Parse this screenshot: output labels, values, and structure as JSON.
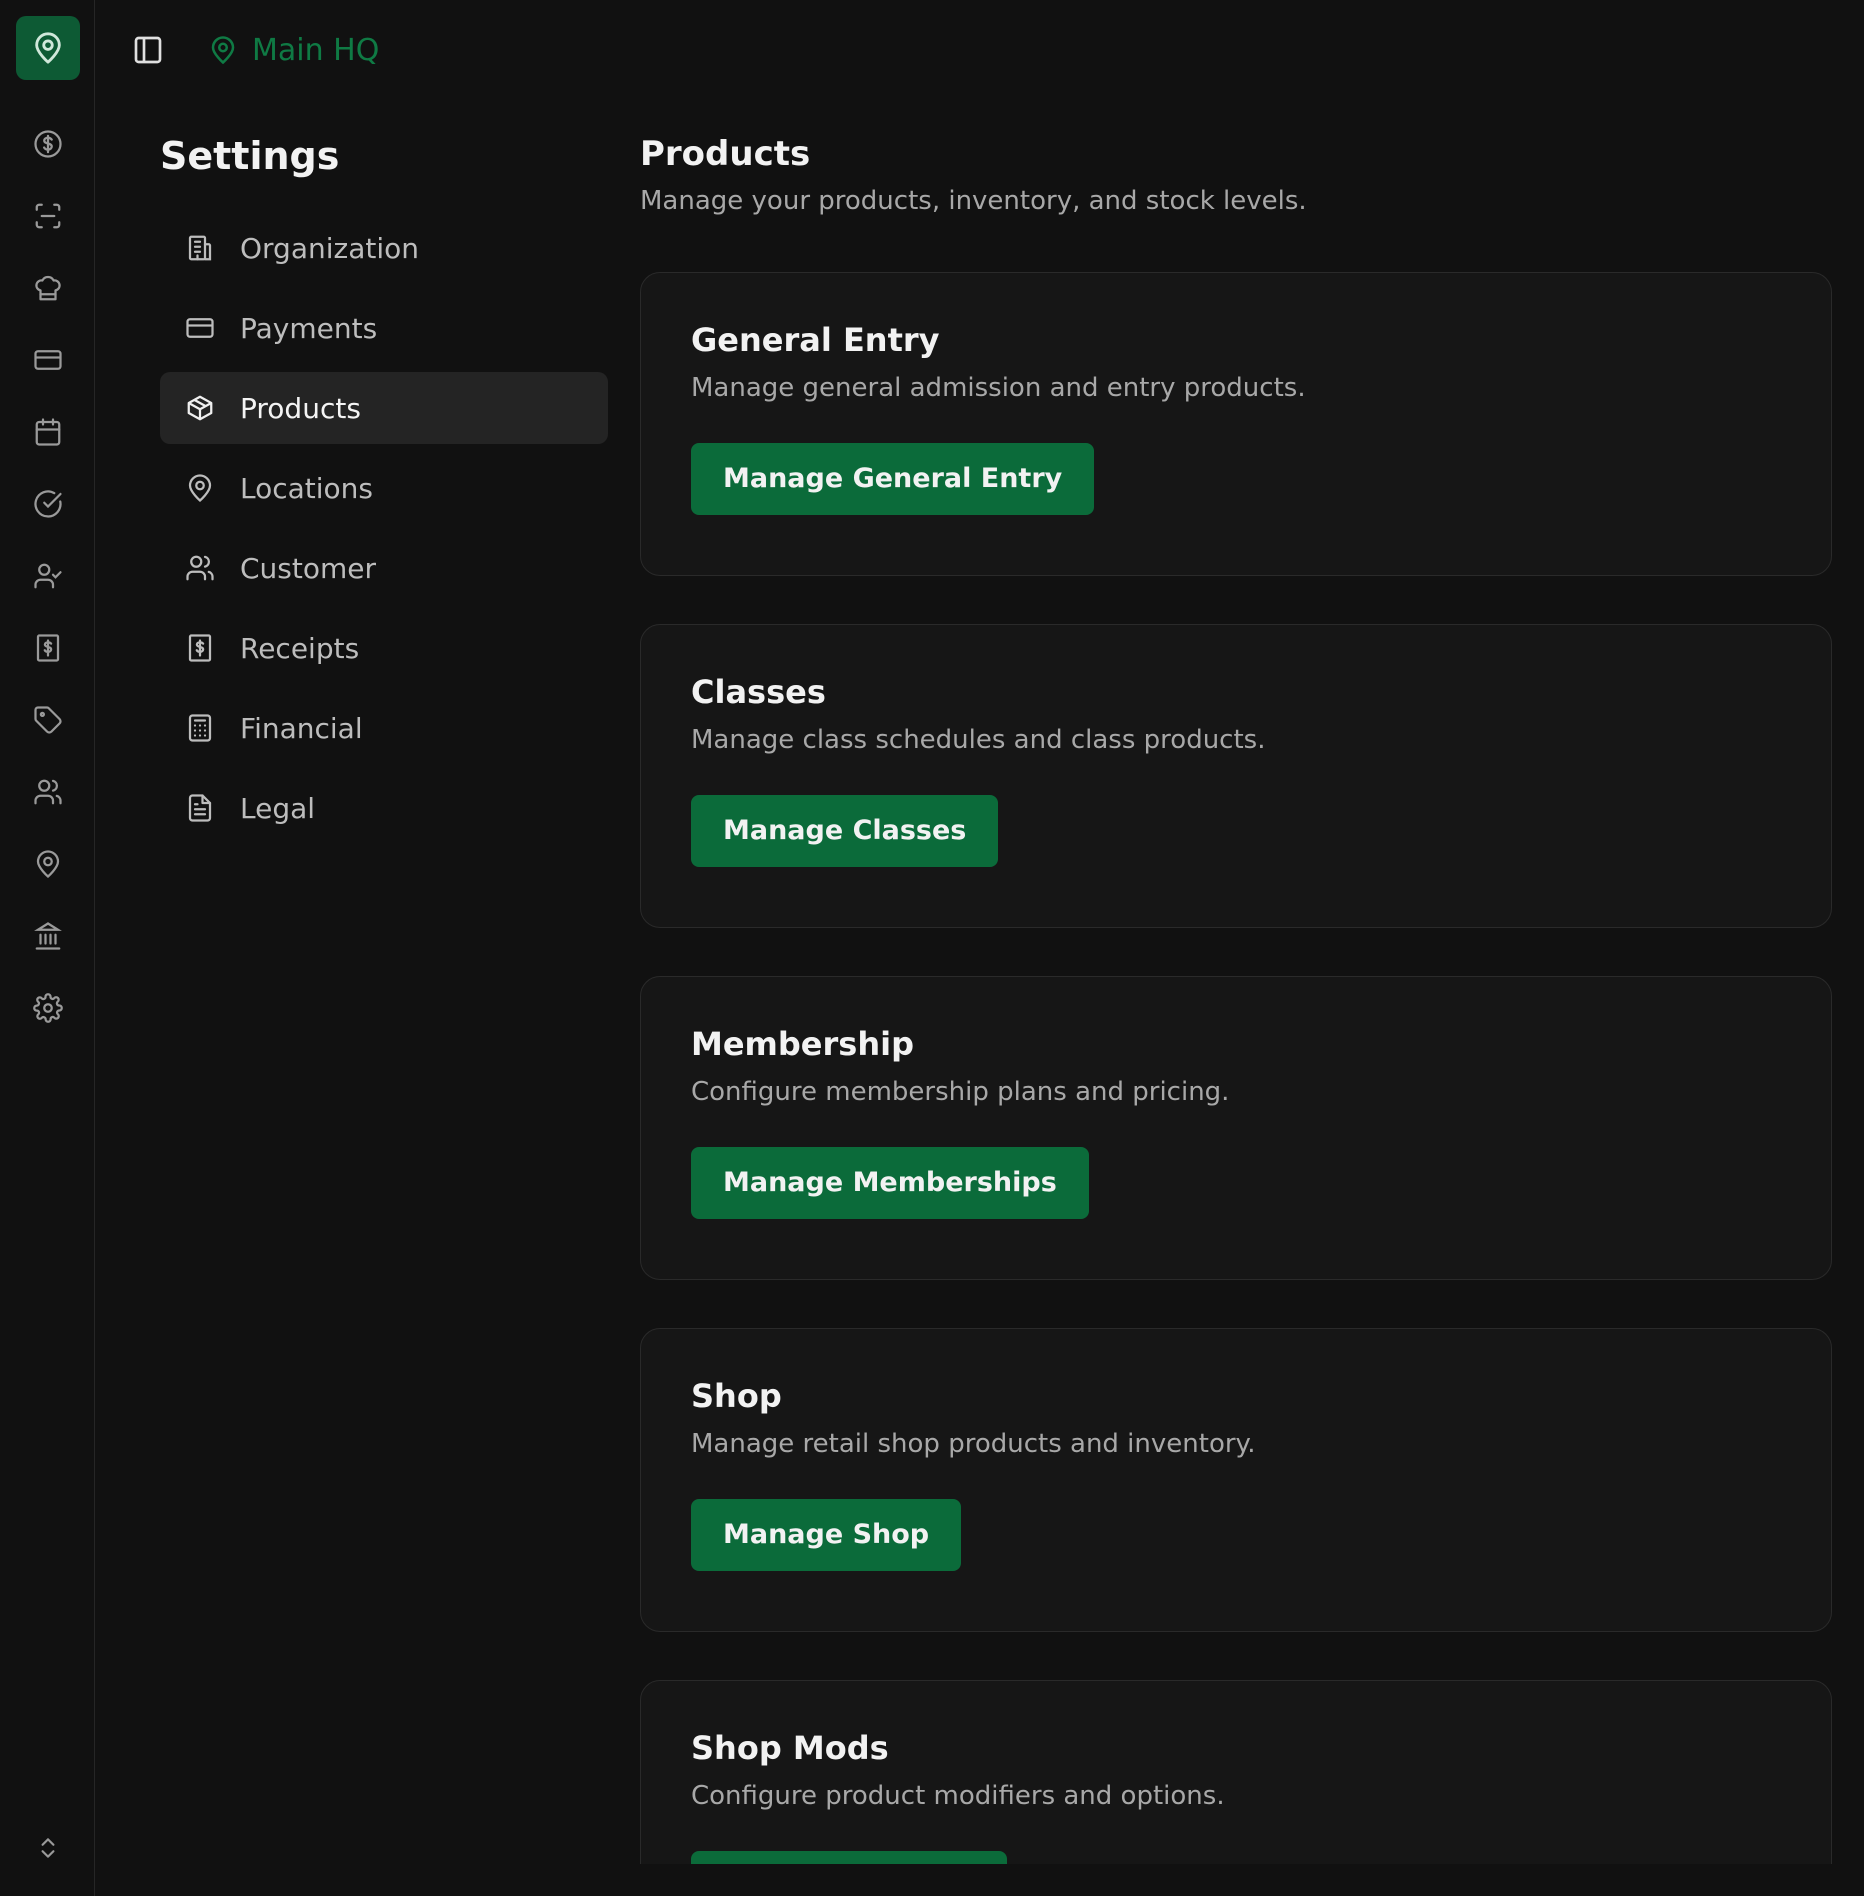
{
  "app": {
    "accent": "#0b6b3a",
    "location_color": "#0f7a44"
  },
  "rail": {
    "logo_icon": "map-pin-icon",
    "icons": [
      "dollar-circle-icon",
      "scan-icon",
      "chef-hat-icon",
      "credit-card-icon",
      "calendar-icon",
      "check-circle-icon",
      "user-check-icon",
      "receipt-dollar-icon",
      "tag-icon",
      "users-icon",
      "map-pin-icon",
      "bank-icon",
      "gear-icon"
    ],
    "footer_icon": "chevron-up-down-icon"
  },
  "topbar": {
    "toggle_icon": "sidebar-toggle-icon",
    "location_label": "Main HQ"
  },
  "settings": {
    "title": "Settings",
    "nav": [
      {
        "label": "Organization",
        "icon": "building-icon"
      },
      {
        "label": "Payments",
        "icon": "credit-card-icon"
      },
      {
        "label": "Products",
        "icon": "package-icon",
        "active": true
      },
      {
        "label": "Locations",
        "icon": "map-pin-icon"
      },
      {
        "label": "Customer",
        "icon": "users-icon"
      },
      {
        "label": "Receipts",
        "icon": "receipt-dollar-icon"
      },
      {
        "label": "Financial",
        "icon": "calculator-icon"
      },
      {
        "label": "Legal",
        "icon": "document-icon"
      }
    ]
  },
  "main": {
    "title": "Products",
    "subtitle": "Manage your products, inventory, and stock levels.",
    "cards": [
      {
        "title": "General Entry",
        "description": "Manage general admission and entry products.",
        "button": "Manage General Entry"
      },
      {
        "title": "Classes",
        "description": "Manage class schedules and class products.",
        "button": "Manage Classes"
      },
      {
        "title": "Membership",
        "description": "Configure membership plans and pricing.",
        "button": "Manage Memberships"
      },
      {
        "title": "Shop",
        "description": "Manage retail shop products and inventory.",
        "button": "Manage Shop"
      },
      {
        "title": "Shop Mods",
        "description": "Configure product modifiers and options.",
        "button": ""
      }
    ]
  }
}
